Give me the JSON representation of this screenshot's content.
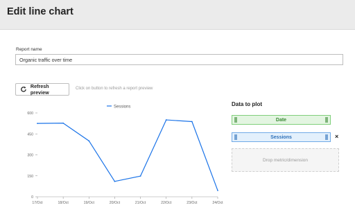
{
  "header": {
    "title": "Edit line chart"
  },
  "form": {
    "report_name_label": "Report name",
    "report_name_value": "Organic traffic over time"
  },
  "toolbar": {
    "refresh_label": "Refresh preview",
    "hint": "Click on button to refresh a report preview"
  },
  "data_panel": {
    "title": "Data to plot",
    "dimension_pill": "Date",
    "metric_pill": "Sessions",
    "remove_symbol": "×",
    "dropzone": "Drop metric/dimension"
  },
  "chart_data": {
    "type": "line",
    "categories": [
      "17/Oct",
      "18/Oct",
      "19/Oct",
      "20/Oct",
      "21/Oct",
      "22/Oct",
      "23/Oct",
      "24/Oct"
    ],
    "series": [
      {
        "name": "Sessions",
        "color": "#1a73e8",
        "values": [
          525,
          527,
          400,
          110,
          148,
          550,
          538,
          45
        ]
      }
    ],
    "yticks": [
      0,
      150,
      300,
      450,
      600
    ],
    "ylim": [
      0,
      600
    ],
    "legend": "top",
    "grid": false
  }
}
